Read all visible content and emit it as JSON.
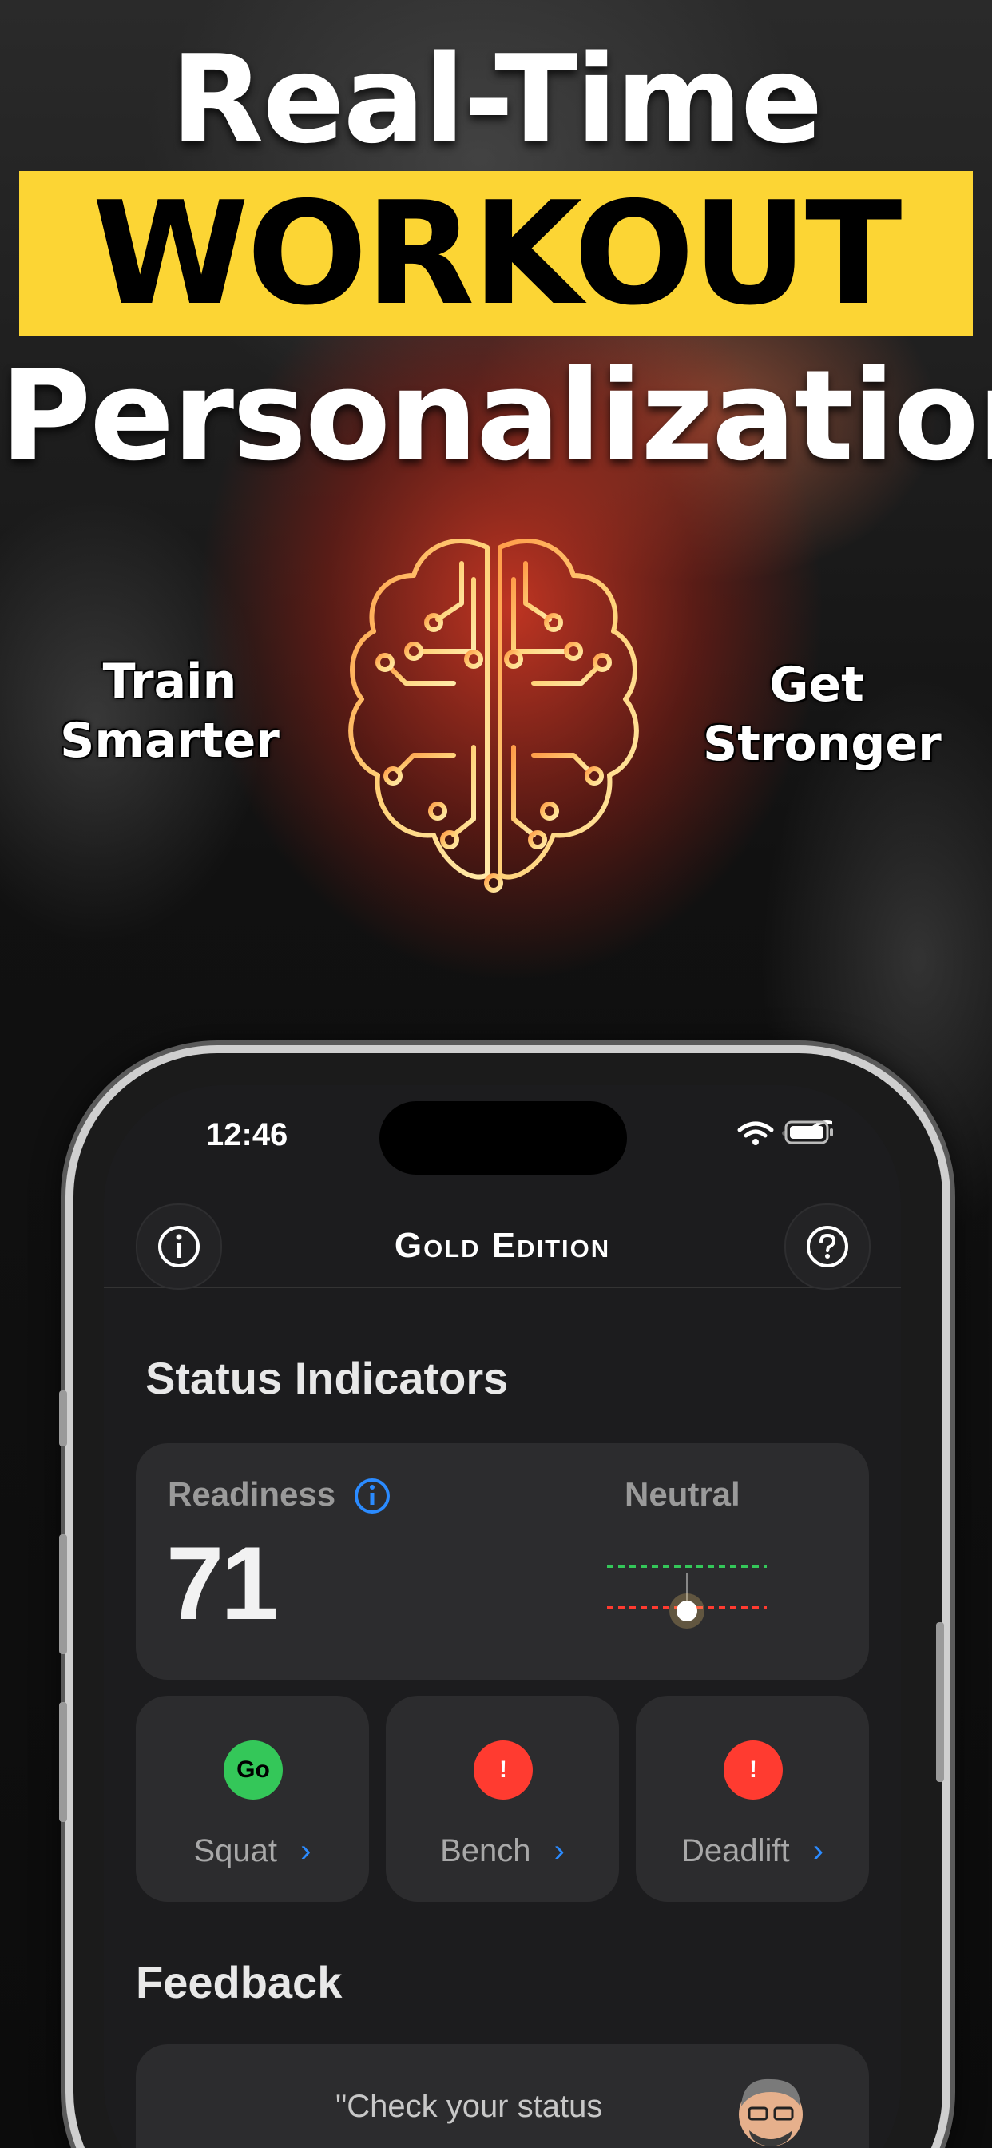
{
  "hero": {
    "line1": "Real-Time",
    "line2": "WORKOUT",
    "line3": "Personalization",
    "left_tag": "Train\nSmarter",
    "right_tag": "Get\nStronger",
    "brain_icon": "circuit-brain-icon"
  },
  "status_bar": {
    "time": "12:46"
  },
  "app": {
    "title": "Gold Edition",
    "info_icon": "info-icon",
    "help_icon": "help-icon"
  },
  "status_indicators": {
    "heading": "Status Indicators",
    "readiness_label": "Readiness",
    "readiness_value": "71",
    "state_label": "Neutral",
    "tiles": [
      {
        "badge": "Go",
        "label": "Squat",
        "color": "#34c759"
      },
      {
        "badge": "!",
        "label": "Bench",
        "color": "#ff3b30"
      },
      {
        "badge": "!",
        "label": "Deadlift",
        "color": "#ff3b30"
      }
    ]
  },
  "feedback": {
    "heading": "Feedback",
    "quote": "\"Check your status"
  },
  "colors": {
    "accent_yellow": "#fcd534",
    "accent_blue": "#2b8bff"
  }
}
